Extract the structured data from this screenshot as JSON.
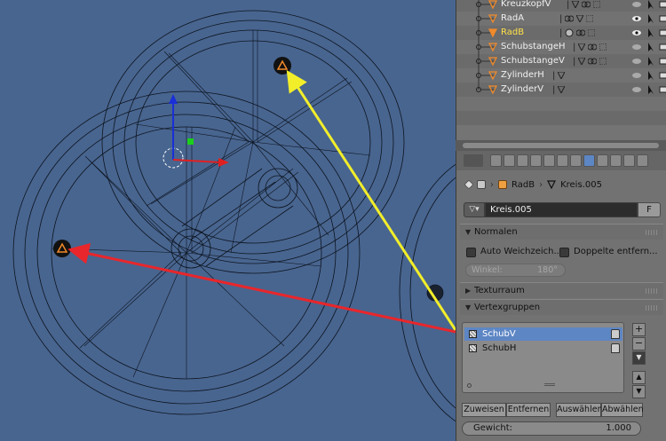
{
  "outliner": {
    "items": [
      {
        "name": "KreuzkopfV",
        "selected": false
      },
      {
        "name": "RadA",
        "selected": false
      },
      {
        "name": "RadB",
        "selected": true
      },
      {
        "name": "SchubstangeH",
        "selected": false
      },
      {
        "name": "SchubstangeV",
        "selected": false
      },
      {
        "name": "ZylinderH",
        "selected": false
      },
      {
        "name": "ZylinderV",
        "selected": false
      }
    ]
  },
  "properties": {
    "breadcrumb": {
      "object": "RadB",
      "mesh": "Kreis.005"
    },
    "mesh_name": "Kreis.005",
    "fake_user_label": "F",
    "normals_panel": {
      "title": "Normalen",
      "auto_smooth_label": "Auto Weichzeich...",
      "double_sided_label": "Doppelte entfern...",
      "angle_label": "Winkel:",
      "angle_value": "180°"
    },
    "texture_space_panel": {
      "title": "Texturraum"
    },
    "vertex_groups_panel": {
      "title": "Vertexgruppen",
      "groups": [
        {
          "name": "SchubV",
          "selected": true
        },
        {
          "name": "SchubH",
          "selected": false
        }
      ],
      "add_label": "+",
      "remove_label": "−",
      "menu_label": "▼",
      "up_label": "▲",
      "down_label": "▼",
      "assign_label": "Zuweisen",
      "remove_assign_label": "Entfernen",
      "select_label": "Auswählen",
      "deselect_label": "Abwählen",
      "weight_label": "Gewicht:",
      "weight_value": "1.000"
    }
  },
  "colors": {
    "viewport_bg": "#48658f",
    "annotation_red": "#e8262b",
    "annotation_yellow": "#f2ee2a",
    "selection_blue": "#5d86c4",
    "selected_text": "#ffe14a"
  }
}
